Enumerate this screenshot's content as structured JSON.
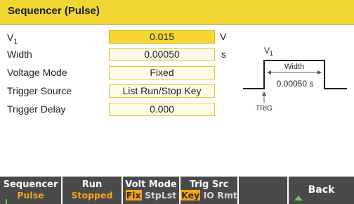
{
  "title": "Sequencer (Pulse)",
  "rows": [
    {
      "label": "V",
      "label_sub": "1",
      "value": "0.015",
      "unit": "V",
      "selected": true
    },
    {
      "label": "Width",
      "value": "0.00050",
      "unit": "s"
    },
    {
      "label": "Voltage Mode",
      "value": "Fixed",
      "unit": ""
    },
    {
      "label": "Trigger Source",
      "value": "List Run/Stop Key",
      "unit": ""
    },
    {
      "label": "Trigger Delay",
      "value": "0.000",
      "unit": ""
    }
  ],
  "diagram": {
    "v_label": "V",
    "v_sub": "1",
    "width_label": "Width",
    "width_value": "0.00050 s",
    "trig_label": "TRIG"
  },
  "softkeys": [
    {
      "top": "Sequencer",
      "bottom": "Pulse"
    },
    {
      "top": "Run",
      "bottom": "Stopped"
    },
    {
      "top": "Volt Mode",
      "options": [
        "Fix",
        "Stp",
        "Lst"
      ],
      "active": 0
    },
    {
      "top": "Trig Src",
      "options": [
        "Key",
        "IO",
        "Rmt"
      ],
      "active": 0
    },
    {
      "top": "",
      "bottom": ""
    },
    {
      "top": "Back"
    }
  ],
  "colors": {
    "title_bar": "#f2d632",
    "field_border": "#e6c637",
    "selected_field": "#f6d633",
    "softkey_bg": "#4a4a4a",
    "accent_orange": "#f2a51f",
    "indicator_green": "#6acb52"
  }
}
